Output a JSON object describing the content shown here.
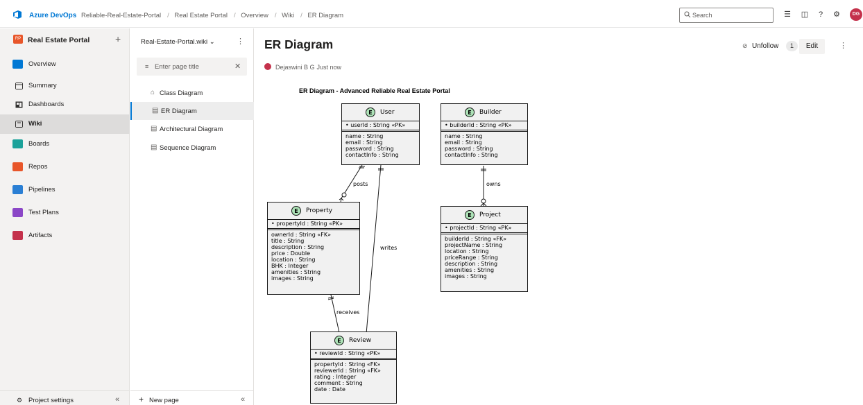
{
  "header": {
    "brand": "Azure DevOps",
    "breadcrumbs": [
      "Reliable-Real-Estate-Portal",
      "Real Estate Portal",
      "Overview",
      "Wiki",
      "ER Diagram"
    ],
    "search_placeholder": "Search",
    "avatar_initials": "DG"
  },
  "sidebar": {
    "project_badge": "RP",
    "project_name": "Real Estate Portal",
    "items": [
      {
        "label": "Overview"
      },
      {
        "label": "Summary"
      },
      {
        "label": "Dashboards"
      },
      {
        "label": "Wiki"
      },
      {
        "label": "Boards"
      },
      {
        "label": "Repos"
      },
      {
        "label": "Pipelines"
      },
      {
        "label": "Test Plans"
      },
      {
        "label": "Artifacts"
      }
    ],
    "settings_label": "Project settings"
  },
  "wiki_tree": {
    "wiki_name": "Real-Estate-Portal.wiki",
    "filter_placeholder": "Enter page title",
    "pages": [
      {
        "label": "Class Diagram"
      },
      {
        "label": "ER Diagram"
      },
      {
        "label": "Architectural Diagram"
      },
      {
        "label": "Sequence Diagram"
      }
    ],
    "new_page_label": "New page"
  },
  "page": {
    "title": "ER Diagram",
    "author": "Dejaswini B G",
    "time": "Just now",
    "unfollow_label": "Unfollow",
    "follower_count": "1",
    "edit_label": "Edit"
  },
  "diagram": {
    "title": "ER Diagram - Advanced Reliable Real Estate Portal",
    "entities": {
      "user": {
        "name": "User",
        "pk": "• userId : String «PK»",
        "attrs": [
          "name : String",
          "email : String",
          "password : String",
          "contactInfo : String"
        ]
      },
      "builder": {
        "name": "Builder",
        "pk": "• builderId : String «PK»",
        "attrs": [
          "name : String",
          "email : String",
          "password : String",
          "contactInfo : String"
        ]
      },
      "property": {
        "name": "Property",
        "pk": "• propertyId : String «PK»",
        "attrs": [
          "ownerId : String «FK»",
          "title : String",
          "description : String",
          "price : Double",
          "location : String",
          "BHK : Integer",
          "amenities : String",
          "images : String"
        ]
      },
      "project": {
        "name": "Project",
        "pk": "• projectId : String «PK»",
        "attrs": [
          "builderId : String «FK»",
          "projectName : String",
          "location : String",
          "priceRange : String",
          "description : String",
          "amenities : String",
          "images : String"
        ]
      },
      "review": {
        "name": "Review",
        "pk": "• reviewId : String «PK»",
        "attrs": [
          "propertyId : String «FK»",
          "reviewerId : String «FK»",
          "rating : Integer",
          "comment : String",
          "date : Date"
        ]
      }
    },
    "relations": {
      "posts": "posts",
      "owns": "owns",
      "writes": "writes",
      "receives": "receives"
    }
  }
}
